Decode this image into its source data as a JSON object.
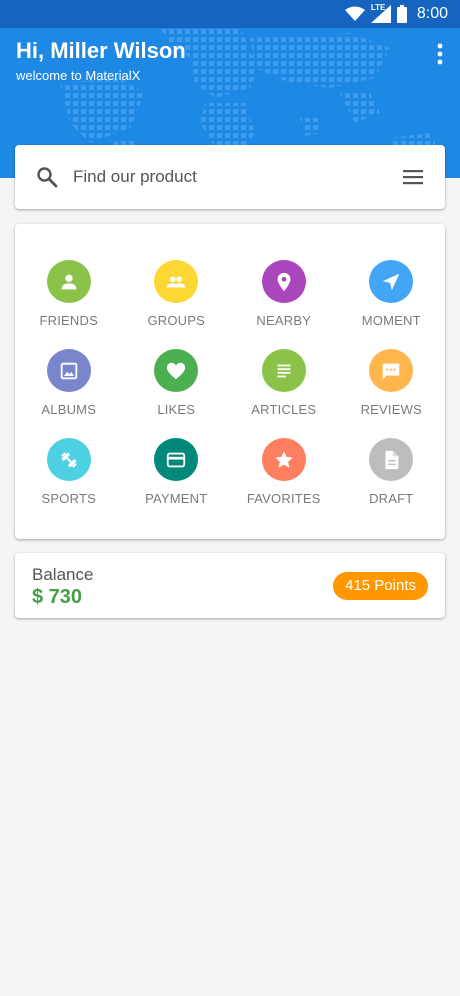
{
  "status_bar": {
    "time": "8:00",
    "network": "LTE"
  },
  "header": {
    "greeting": "Hi, Miller Wilson",
    "subtitle": "welcome to MaterialX"
  },
  "search": {
    "placeholder": "Find our product"
  },
  "menu": [
    {
      "label": "FRIENDS",
      "icon": "person-icon",
      "color": "#8bc34a"
    },
    {
      "label": "GROUPS",
      "icon": "group-icon",
      "color": "#fdd835"
    },
    {
      "label": "NEARBY",
      "icon": "location-pin-icon",
      "color": "#ab47bc"
    },
    {
      "label": "MOMENT",
      "icon": "send-icon",
      "color": "#42a5f5"
    },
    {
      "label": "ALBUMS",
      "icon": "image-icon",
      "color": "#7986cb"
    },
    {
      "label": "LIKES",
      "icon": "heart-icon",
      "color": "#4caf50"
    },
    {
      "label": "ARTICLES",
      "icon": "article-icon",
      "color": "#8bc34a"
    },
    {
      "label": "REVIEWS",
      "icon": "chat-bubble-icon",
      "color": "#ffb74d"
    },
    {
      "label": "SPORTS",
      "icon": "fitness-icon",
      "color": "#4dd0e1"
    },
    {
      "label": "PAYMENT",
      "icon": "credit-card-icon",
      "color": "#00897b"
    },
    {
      "label": "FAVORITES",
      "icon": "star-icon",
      "color": "#ff7f61"
    },
    {
      "label": "DRAFT",
      "icon": "document-icon",
      "color": "#bdbdbd"
    }
  ],
  "balance": {
    "label": "Balance",
    "amount": "$ 730",
    "points": "415 Points"
  }
}
